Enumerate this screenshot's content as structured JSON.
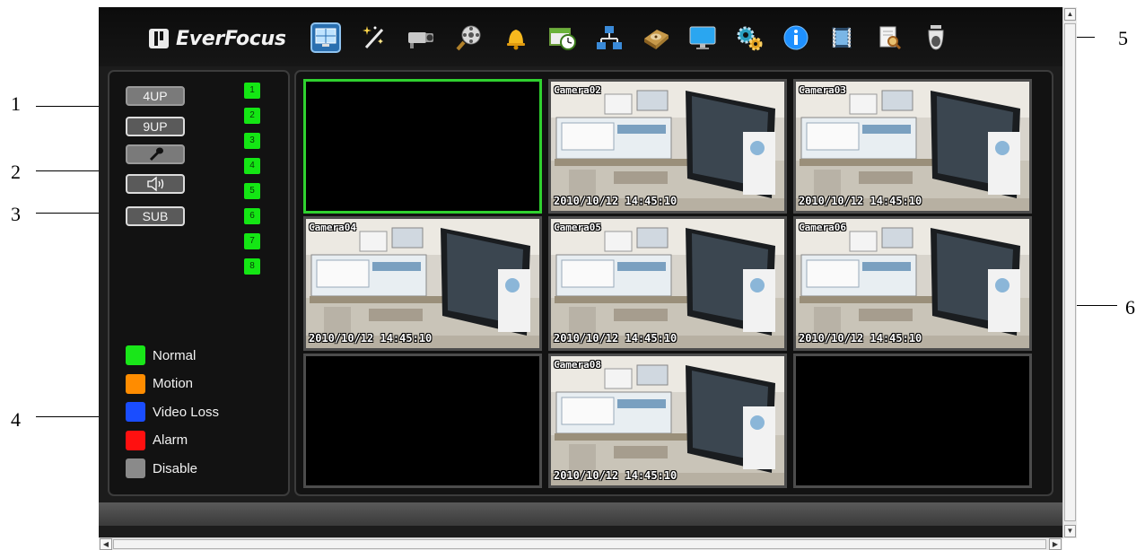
{
  "callouts": [
    "1",
    "2",
    "3",
    "4",
    "5",
    "6"
  ],
  "app": {
    "logo_text": "EverFocus",
    "toolbar": [
      {
        "icon": "live-view-icon",
        "active": true
      },
      {
        "icon": "wizard-icon"
      },
      {
        "icon": "camera-icon"
      },
      {
        "icon": "search-film-icon"
      },
      {
        "icon": "alarm-bell-icon"
      },
      {
        "icon": "schedule-icon"
      },
      {
        "icon": "network-icon"
      },
      {
        "icon": "hdd-icon"
      },
      {
        "icon": "display-icon"
      },
      {
        "icon": "settings-gears-icon"
      },
      {
        "icon": "info-icon"
      },
      {
        "icon": "video-clip-icon"
      },
      {
        "icon": "log-search-icon"
      },
      {
        "icon": "dome-camera-icon"
      }
    ]
  },
  "left_panel": {
    "buttons": {
      "four_up": "4UP",
      "nine_up": "9UP",
      "mic_icon": "microphone-icon",
      "speaker_icon": "speaker-icon",
      "sub": "SUB"
    },
    "channels": [
      "1",
      "2",
      "3",
      "4",
      "5",
      "6",
      "7",
      "8"
    ],
    "legend": [
      {
        "label": "Normal",
        "color": "#19e619"
      },
      {
        "label": "Motion",
        "color": "#ff8c00"
      },
      {
        "label": "Video Loss",
        "color": "#1a4dff"
      },
      {
        "label": "Alarm",
        "color": "#ff1010"
      },
      {
        "label": "Disable",
        "color": "#8a8a8a"
      }
    ]
  },
  "grid": {
    "cells": [
      {
        "name": "",
        "timestamp": "",
        "video": false,
        "selected": true
      },
      {
        "name": "Camera02",
        "timestamp": "2010/10/12  14:45:10",
        "video": true
      },
      {
        "name": "Camera03",
        "timestamp": "2010/10/12  14:45:10",
        "video": true
      },
      {
        "name": "Camera04",
        "timestamp": "2010/10/12  14:45:10",
        "video": true
      },
      {
        "name": "Camera05",
        "timestamp": "2010/10/12  14:45:10",
        "video": true
      },
      {
        "name": "Camera06",
        "timestamp": "2010/10/12  14:45:10",
        "video": true
      },
      {
        "name": "",
        "timestamp": "",
        "video": false
      },
      {
        "name": "Camera08",
        "timestamp": "2010/10/12  14:45:10",
        "video": true
      },
      {
        "name": "",
        "timestamp": "",
        "video": false
      }
    ]
  },
  "colors": {
    "channel_active": "#14e614",
    "selected_border": "#2fd12f",
    "background": "#1c1c1c"
  }
}
